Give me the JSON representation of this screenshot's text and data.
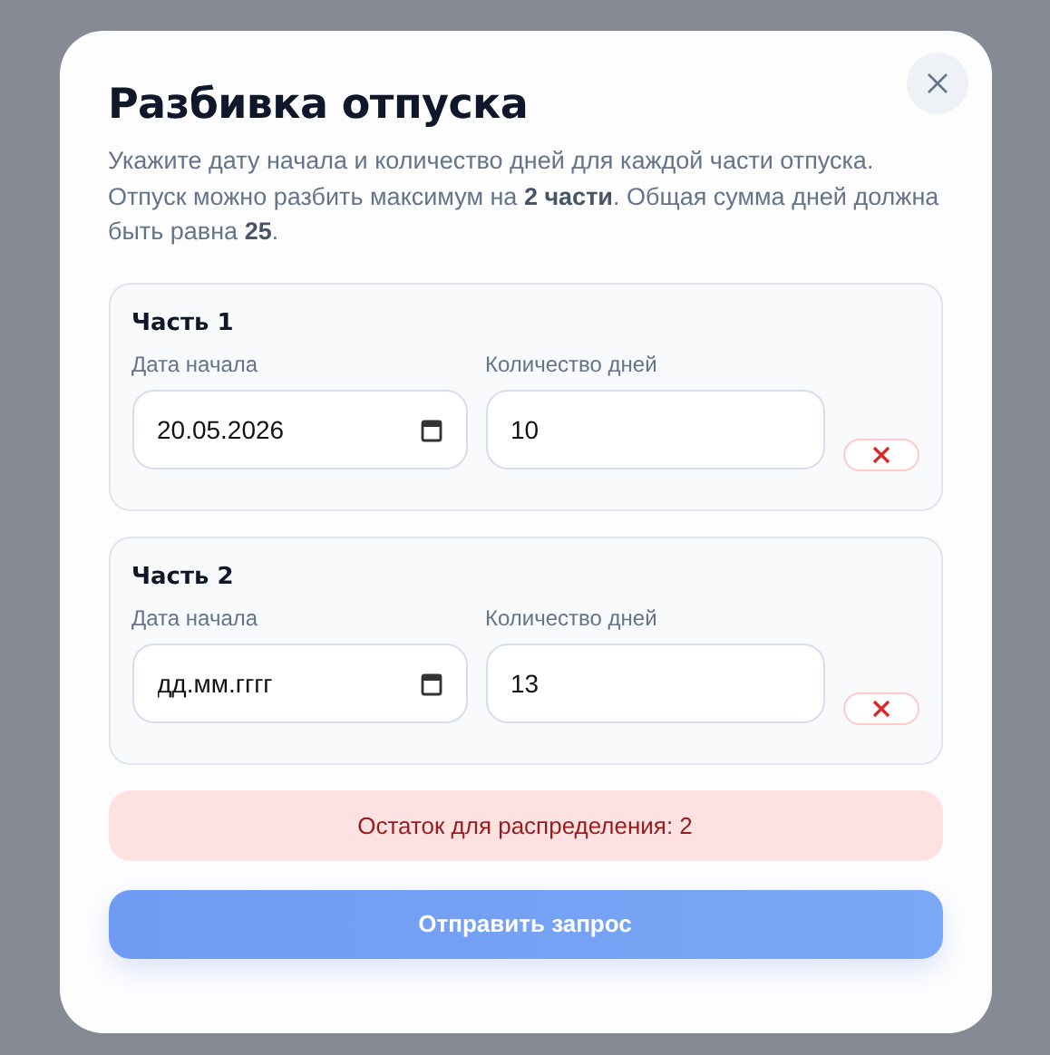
{
  "dialog": {
    "title": "Разбивка отпуска",
    "description": "Укажите дату начала и количество дней для каждой части отпуска. Отпуск можно разбить максимум на **2 части**. Общая сумма дней должна быть равна **25**.",
    "parts": [
      {
        "title": "Часть 1",
        "date_label": "Дата начала",
        "date": {
          "value": "20.05.2026"
        },
        "days_label": "Количество дней",
        "days": {
          "value": "10"
        }
      },
      {
        "title": "Часть 2",
        "date_label": "Дата начала",
        "date": {
          "placeholder": "дд.мм.гггг"
        },
        "days_label": "Количество дней",
        "days": {
          "value": "13"
        }
      }
    ],
    "remainder": {
      "text": "Остаток для распределения: 2",
      "kind": "error"
    },
    "submit": {
      "label": "Отправить запрос",
      "disabled": true
    }
  }
}
